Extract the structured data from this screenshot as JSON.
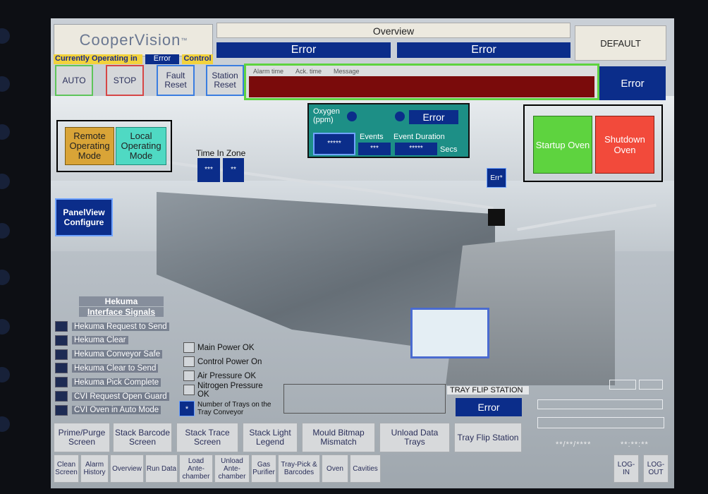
{
  "header": {
    "logo_text": "CooperVision",
    "logo_tm": "™",
    "screen_title": "Overview",
    "status_left": "Error",
    "status_right": "Error",
    "default_label": "DEFAULT",
    "currently_operating_in": "Currently Operating in",
    "error_label": "Error",
    "control_label": "Control"
  },
  "mode_buttons": {
    "auto": "AUTO",
    "stop": "STOP",
    "fault_reset": "Fault\nReset",
    "station_reset": "Station\nReset"
  },
  "alarm": {
    "col_time": "Alarm time",
    "col_ack": "Ack. time",
    "col_msg": "Message",
    "side_status": "Error"
  },
  "operating_mode": {
    "remote": "Remote Operating Mode",
    "local": "Local Operating Mode"
  },
  "time_in_zone": {
    "label": "Time In Zone",
    "val1": "***",
    "val2": "**"
  },
  "oxygen": {
    "label": "Oxygen\n(ppm)",
    "status": "Error",
    "value": "*****",
    "events_label": "Events",
    "events_value": "***",
    "duration_label": "Event Duration",
    "duration_value": "*****",
    "secs": "Secs"
  },
  "oven": {
    "startup": "Startup Oven",
    "shutdown": "Shutdown Oven"
  },
  "err_tag": "Err*",
  "panelview": "PanelView Configure",
  "hekuma": {
    "title": "Hekuma",
    "subtitle": "Interface Signals",
    "signals": [
      "Hekuma Request to Send",
      "Hekuma Clear",
      "Hekuma Conveyor Safe",
      "Hekuma Clear to Send",
      "Hekuma Pick Complete",
      "CVI Request Open Guard",
      "CVI Oven in Auto Mode"
    ]
  },
  "plant_indicators": [
    "Main Power OK",
    "Control Power On",
    "Air Pressure OK",
    "Nitrogen Pressure OK"
  ],
  "trays": {
    "count": "*",
    "label": "Number of Trays on the Tray Conveyor"
  },
  "tray_flip": {
    "label": "TRAY FLIP STATION",
    "status": "Error"
  },
  "function_buttons": [
    "Prime/Purge Screen",
    "Stack Barcode Screen",
    "Stack Trace Screen",
    "Stack Light Legend",
    "Mould Bitmap Mismatch",
    "Unload Data Trays",
    "Tray Flip Station"
  ],
  "datetime": {
    "date": "**/**/****",
    "time": "**:**:**"
  },
  "nav_buttons": [
    "Clean Screen",
    "Alarm History",
    "Overview",
    "Run Data",
    "Load Ante-chamber",
    "Unload Ante-chamber",
    "Gas Purifier",
    "Tray-Pick & Barcodes",
    "Oven",
    "Cavities"
  ],
  "login": "LOG-IN",
  "logout": "LOG-OUT",
  "colors": {
    "blue": "#0b2d8a",
    "green": "#5ed33f",
    "red": "#f24a3b",
    "amber": "#d9a437",
    "teal": "#4fd9c3",
    "alarm_red": "#7a0b0b",
    "yellow": "#f2d23c"
  }
}
